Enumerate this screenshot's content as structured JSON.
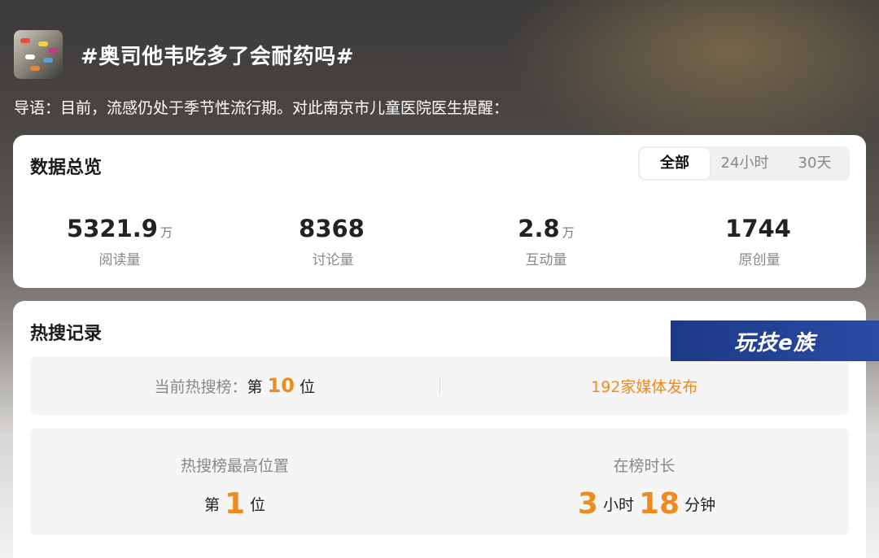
{
  "topic": {
    "title": "#奥司他韦吃多了会耐药吗#",
    "lead": "导语：目前，流感仍处于季节性流行期。对此南京市儿童医院医生提醒："
  },
  "overview": {
    "title": "数据总览",
    "tabs": [
      "全部",
      "24小时",
      "30天"
    ],
    "active_tab": "全部",
    "stats": [
      {
        "value": "5321.9",
        "unit": "万",
        "label": "阅读量"
      },
      {
        "value": "8368",
        "unit": "",
        "label": "讨论量"
      },
      {
        "value": "2.8",
        "unit": "万",
        "label": "互动量"
      },
      {
        "value": "1744",
        "unit": "",
        "label": "原创量"
      }
    ]
  },
  "hot": {
    "title": "热搜记录",
    "current_prefix": "当前热搜榜：",
    "current_di": "第",
    "current_rank": "10",
    "current_wei": "位",
    "media": "192家媒体发布",
    "peak_label": "热搜榜最高位置",
    "peak_di": "第",
    "peak_rank": "1",
    "peak_wei": "位",
    "duration_label": "在榜时长",
    "hours": "3",
    "hours_unit": "小时",
    "minutes": "18",
    "minutes_unit": "分钟"
  },
  "watermark": "玩技e族",
  "colors": {
    "accent": "#f08a1c",
    "watermark_bg": "#1d3a86"
  }
}
